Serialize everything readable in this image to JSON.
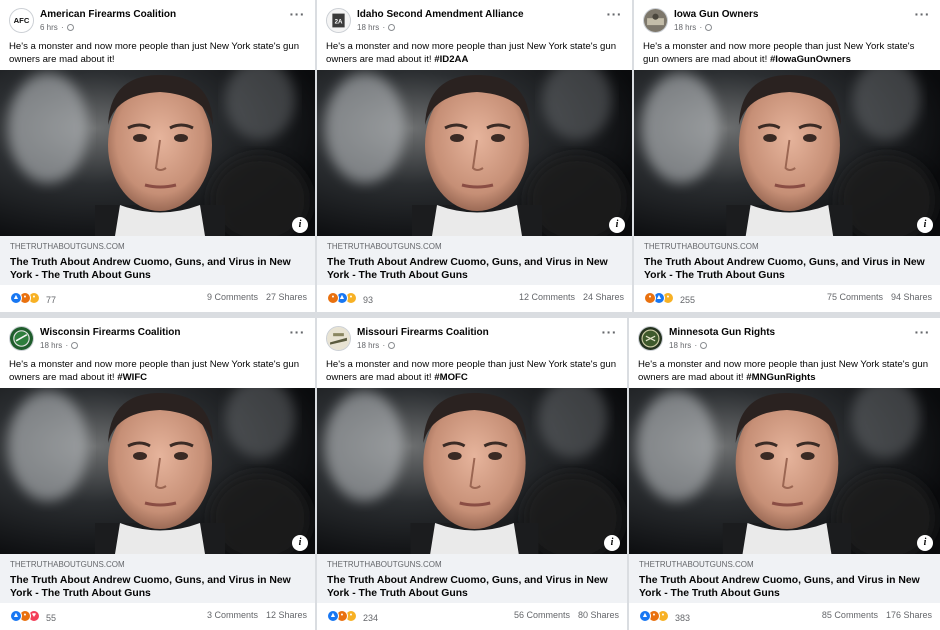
{
  "posts": [
    {
      "page_name": "American Firearms Coalition",
      "avatar_icon": "afc-logo-icon",
      "avatar_text": "AFC",
      "time": "6 hrs",
      "body": "He's a monster and now more people than just New York state's gun owners are mad about it!",
      "hashtag": "",
      "link_domain": "THETRUTHABOUTGUNS.COM",
      "link_title": "The Truth About Andrew Cuomo, Guns, and Virus in New York - The Truth About Guns",
      "reactions": [
        "like",
        "angry",
        "haha"
      ],
      "reaction_count": "77",
      "comments": "9 Comments",
      "shares": "27 Shares"
    },
    {
      "page_name": "Idaho Second Amendment Alliance",
      "avatar_icon": "isaa-logo-icon",
      "avatar_text": "2A",
      "time": "18 hrs",
      "body": "He's a monster and now more people than just New York state's gun owners are mad about it!",
      "hashtag": "#ID2AA",
      "link_domain": "THETRUTHABOUTGUNS.COM",
      "link_title": "The Truth About Andrew Cuomo, Guns, and Virus in New York - The Truth About Guns",
      "reactions": [
        "angry",
        "like",
        "wow"
      ],
      "reaction_count": "93",
      "comments": "12 Comments",
      "shares": "24 Shares"
    },
    {
      "page_name": "Iowa Gun Owners",
      "avatar_icon": "igo-logo-icon",
      "avatar_text": "",
      "time": "18 hrs",
      "body": "He's a monster and now more people than just New York state's gun owners are mad about it!",
      "hashtag": "#IowaGunOwners",
      "link_domain": "THETRUTHABOUTGUNS.COM",
      "link_title": "The Truth About Andrew Cuomo, Guns, and Virus in New York - The Truth About Guns",
      "reactions": [
        "angry",
        "like",
        "haha"
      ],
      "reaction_count": "255",
      "comments": "75 Comments",
      "shares": "94 Shares"
    },
    {
      "page_name": "Wisconsin Firearms Coalition",
      "avatar_icon": "wifc-logo-icon",
      "avatar_text": "",
      "time": "18 hrs",
      "body": "He's a monster and now more people than just New York state's gun owners are mad about it!",
      "hashtag": "#WIFC",
      "link_domain": "THETRUTHABOUTGUNS.COM",
      "link_title": "The Truth About Andrew Cuomo, Guns, and Virus in New York - The Truth About Guns",
      "reactions": [
        "like",
        "angry",
        "love"
      ],
      "reaction_count": "55",
      "comments": "3 Comments",
      "shares": "12 Shares"
    },
    {
      "page_name": "Missouri Firearms Coalition",
      "avatar_icon": "mofc-logo-icon",
      "avatar_text": "",
      "time": "18 hrs",
      "body": "He's a monster and now more people than just New York state's gun owners are mad about it!",
      "hashtag": "#MOFC",
      "link_domain": "THETRUTHABOUTGUNS.COM",
      "link_title": "The Truth About Andrew Cuomo, Guns, and Virus in New York - The Truth About Guns",
      "reactions": [
        "like",
        "angry",
        "haha"
      ],
      "reaction_count": "234",
      "comments": "56 Comments",
      "shares": "80 Shares"
    },
    {
      "page_name": "Minnesota Gun Rights",
      "avatar_icon": "mngr-logo-icon",
      "avatar_text": "",
      "time": "18 hrs",
      "body": "He's a monster and now more people than just New York state's gun owners are mad about it!",
      "hashtag": "#MNGunRights",
      "link_domain": "THETRUTHABOUTGUNS.COM",
      "link_title": "The Truth About Andrew Cuomo, Guns, and Virus in New York - The Truth About Guns",
      "reactions": [
        "like",
        "angry",
        "haha"
      ],
      "reaction_count": "383",
      "comments": "85 Comments",
      "shares": "176 Shares"
    }
  ],
  "colors": {
    "like": "#1877f2",
    "love": "#f33e58",
    "angry": "#e9710f",
    "haha": "#f7b125",
    "wow": "#f7b125",
    "muted_text": "#65676b",
    "link_box": "#f0f2f5"
  }
}
